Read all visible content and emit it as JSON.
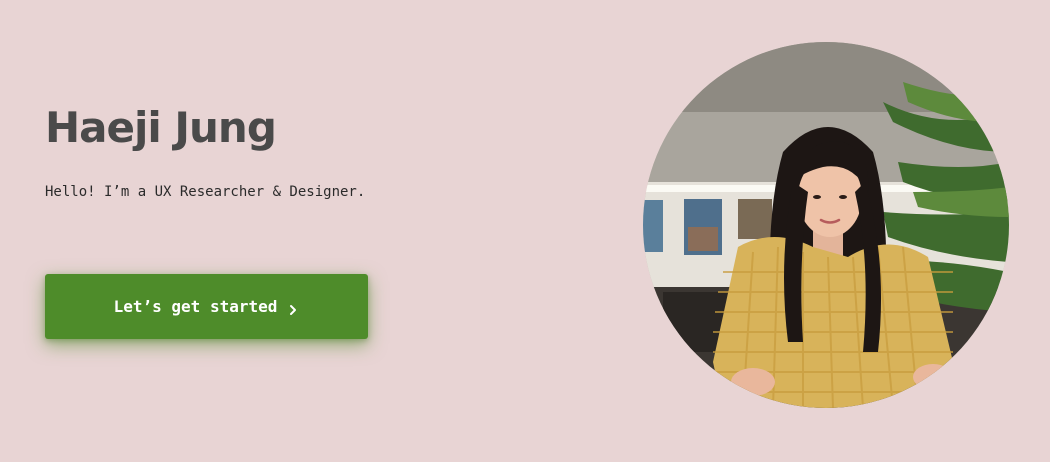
{
  "hero": {
    "name": "Haeji Jung",
    "tagline": "Hello! I’m a UX Researcher & Designer.",
    "cta_label": "Let’s get started",
    "cta_icon": "chevron-right-icon",
    "portrait_alt": "Haeji Jung"
  },
  "colors": {
    "background": "#e8d4d4",
    "heading": "#4a4a4a",
    "button": "#4e8c2a",
    "button_text": "#ffffff"
  }
}
